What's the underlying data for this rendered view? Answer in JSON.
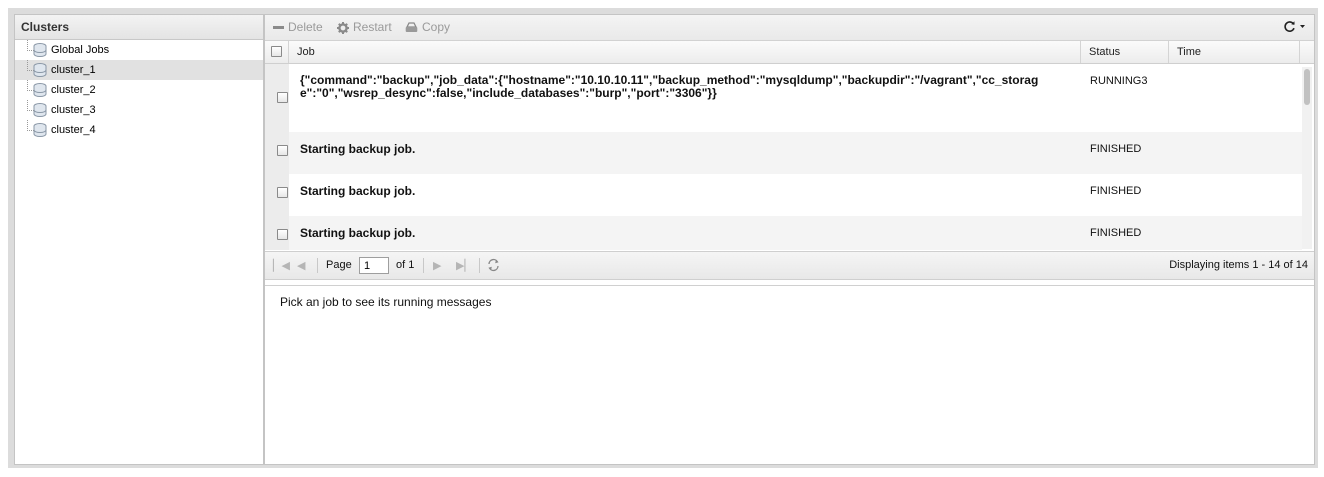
{
  "clusters_panel": {
    "title": "Clusters",
    "items": [
      {
        "label": "Global Jobs"
      },
      {
        "label": "cluster_1"
      },
      {
        "label": "cluster_2"
      },
      {
        "label": "cluster_3"
      },
      {
        "label": "cluster_4"
      }
    ]
  },
  "toolbar": {
    "delete_label": "Delete",
    "restart_label": "Restart",
    "copy_label": "Copy"
  },
  "grid": {
    "columns": {
      "job": "Job",
      "status": "Status",
      "time": "Time"
    },
    "rows": [
      {
        "job": "{\"command\":\"backup\",\"job_data\":{\"hostname\":\"10.10.10.11\",\"backup_method\":\"mysqldump\",\"backupdir\":\"/vagrant\",\"cc_storage\":\"0\",\"wsrep_desync\":false,\"include_databases\":\"burp\",\"port\":\"3306\"}}",
        "status": "RUNNING3",
        "time": ""
      },
      {
        "job": "Starting backup job.",
        "status": "FINISHED",
        "time": ""
      },
      {
        "job": "Starting backup job.",
        "status": "FINISHED",
        "time": ""
      },
      {
        "job": "Starting backup job.",
        "status": "FINISHED",
        "time": ""
      }
    ]
  },
  "pager": {
    "page_label": "Page",
    "current_page": "1",
    "of_label": "of 1",
    "display_info": "Displaying items 1 - 14 of 14"
  },
  "messages": {
    "placeholder": "Pick an job to see its running messages"
  }
}
